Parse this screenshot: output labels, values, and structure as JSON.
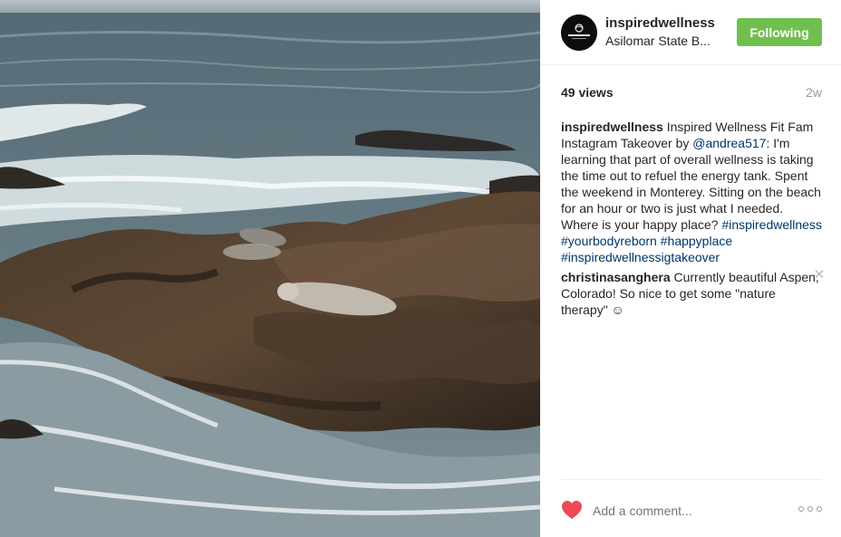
{
  "post": {
    "username": "inspiredwellness",
    "location": "Asilomar State B...",
    "follow_label": "Following",
    "views": "49 views",
    "age": "2w"
  },
  "caption": {
    "username": "inspiredwellness",
    "text_1": " Inspired Wellness Fit Fam Instagram Takeover by ",
    "mention": "@andrea517",
    "text_2": ": I'm learning that part of overall wellness is taking the time out to refuel the energy tank. Spent the weekend in Monterey. Sitting on the beach for an hour or two is just what I needed. Where is your happy place? ",
    "hashtags": [
      "#inspiredwellness",
      "#yourbodyreborn",
      "#happyplace",
      "#inspiredwellnessigtakeover"
    ]
  },
  "reply": {
    "username": "christinasanghera",
    "text": " Currently beautiful Aspen, Colorado! So nice to get some \"nature therapy\" ☺"
  },
  "footer": {
    "comment_placeholder": "Add a comment..."
  },
  "colors": {
    "follow_button": "#70c050",
    "link": "#003569",
    "heart": "#ed4956"
  },
  "icons": {
    "like": "heart-icon",
    "remove": "close-icon",
    "more": "more-options-icon"
  }
}
